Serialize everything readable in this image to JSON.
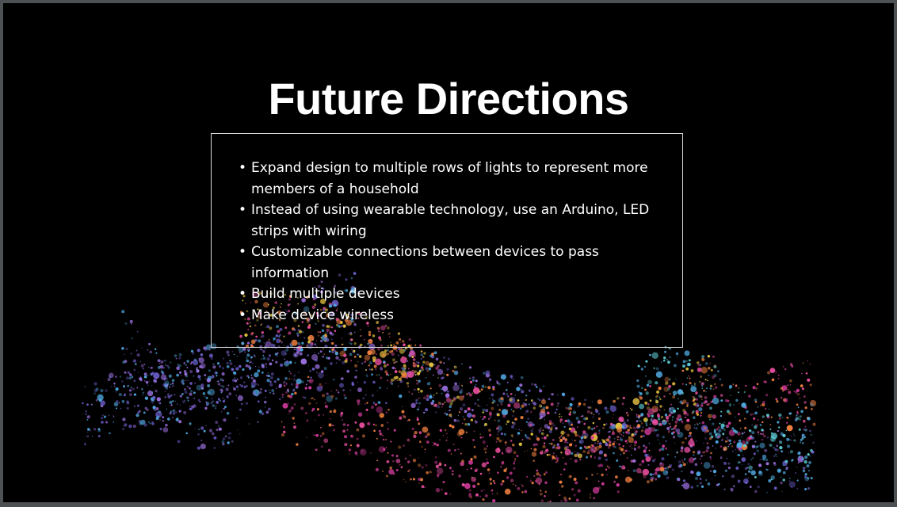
{
  "slide": {
    "title": "Future Directions",
    "bullets": [
      "Expand design to multiple rows of lights to represent more members of a household",
      "Instead of using wearable technology, use an Arduino, LED strips with wiring",
      "Customizable connections between devices to pass information",
      "Build multiple devices",
      "Make device wireless"
    ],
    "bullet_glyph": "•"
  },
  "colors": {
    "background": "#000000",
    "text": "#ffffff",
    "box_border": "#d8d8d8",
    "particles": [
      "#6a5cc8",
      "#4fa8e0",
      "#e0c040",
      "#e84fa0",
      "#f08040",
      "#60d0d8",
      "#9b6fe0",
      "#d03a9a"
    ]
  }
}
